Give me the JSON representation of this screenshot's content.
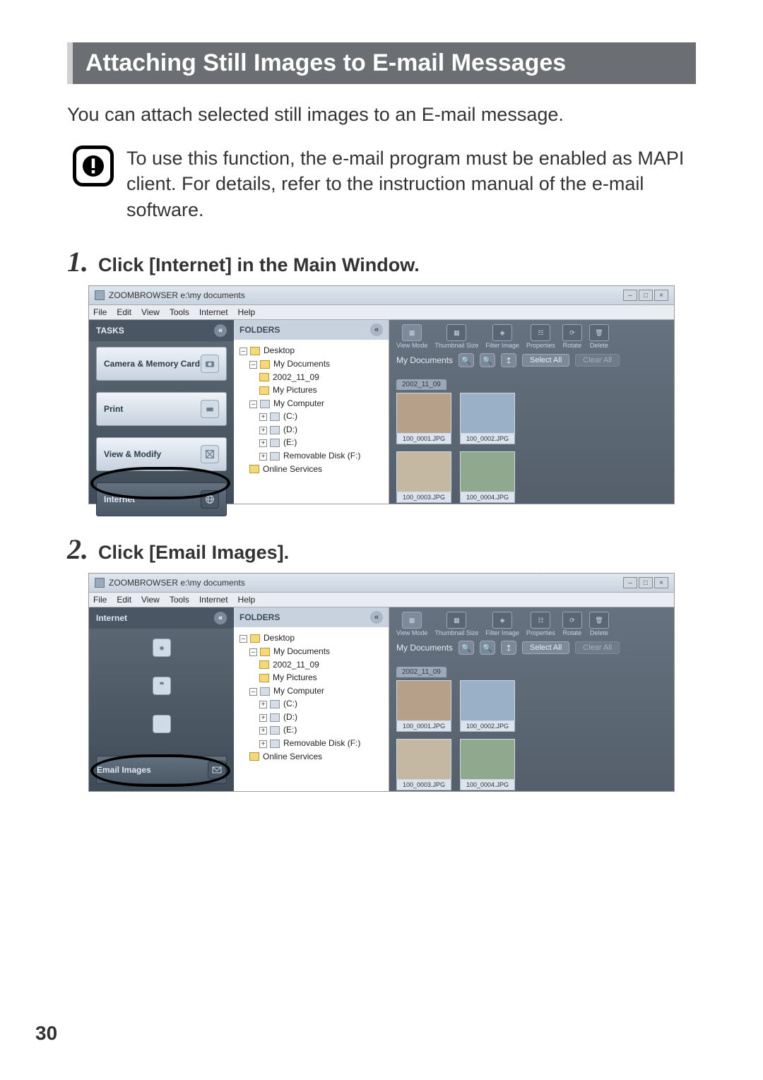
{
  "page": {
    "title": "Attaching Still Images to E-mail Messages",
    "intro": "You can attach selected still images to an E-mail message.",
    "callout": "To use this function, the e-mail program must be enabled as MAPI client. For details, refer to the instruction manual of the e-mail software.",
    "page_number": "30"
  },
  "steps": [
    {
      "num": "1",
      "text": "Click [Internet] in the Main Window."
    },
    {
      "num": "2",
      "text": "Click [Email Images]."
    }
  ],
  "app": {
    "window_title": "ZOOMBROWSER e:\\my documents",
    "menu": [
      "File",
      "Edit",
      "View",
      "Tools",
      "Internet",
      "Help"
    ],
    "tasks_header": "TASKS",
    "internet_header": "Internet",
    "task_items": {
      "camera": "Camera & Memory Card",
      "print": "Print",
      "view": "View & Modify",
      "internet": "Internet",
      "email": "Email Images"
    },
    "folders_header": "FOLDERS",
    "tree": {
      "desktop": "Desktop",
      "mydocs": "My Documents",
      "date": "2002_11_09",
      "mypics": "My Pictures",
      "mycomp": "My Computer",
      "c": "(C:)",
      "d": "(D:)",
      "e": "(E:)",
      "f": "Removable Disk (F:)",
      "online": "Online Services"
    },
    "toolbar_icons": {
      "view_mode": "View Mode",
      "thumbnail": "Thumbnail Size",
      "filter": "Filter Image",
      "properties": "Properties",
      "rotate": "Rotate",
      "delete": "Delete"
    },
    "breadcrumb": "My Documents",
    "select_all": "Select All",
    "clear_all": "Clear All",
    "date_tab": "2002_11_09",
    "thumbs": [
      "100_0001.JPG",
      "100_0002.JPG",
      "100_0003.JPG",
      "100_0004.JPG"
    ]
  }
}
